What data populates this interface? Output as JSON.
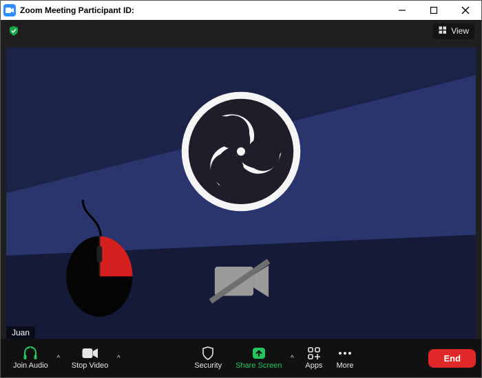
{
  "titlebar": {
    "title": "Zoom Meeting Participant ID:"
  },
  "top": {
    "view_label": "View"
  },
  "participant": {
    "name": "Juan"
  },
  "toolbar": {
    "join_audio": "Join Audio",
    "stop_video": "Stop Video",
    "security": "Security",
    "share_screen": "Share Screen",
    "apps": "Apps",
    "more": "More",
    "end": "End"
  }
}
